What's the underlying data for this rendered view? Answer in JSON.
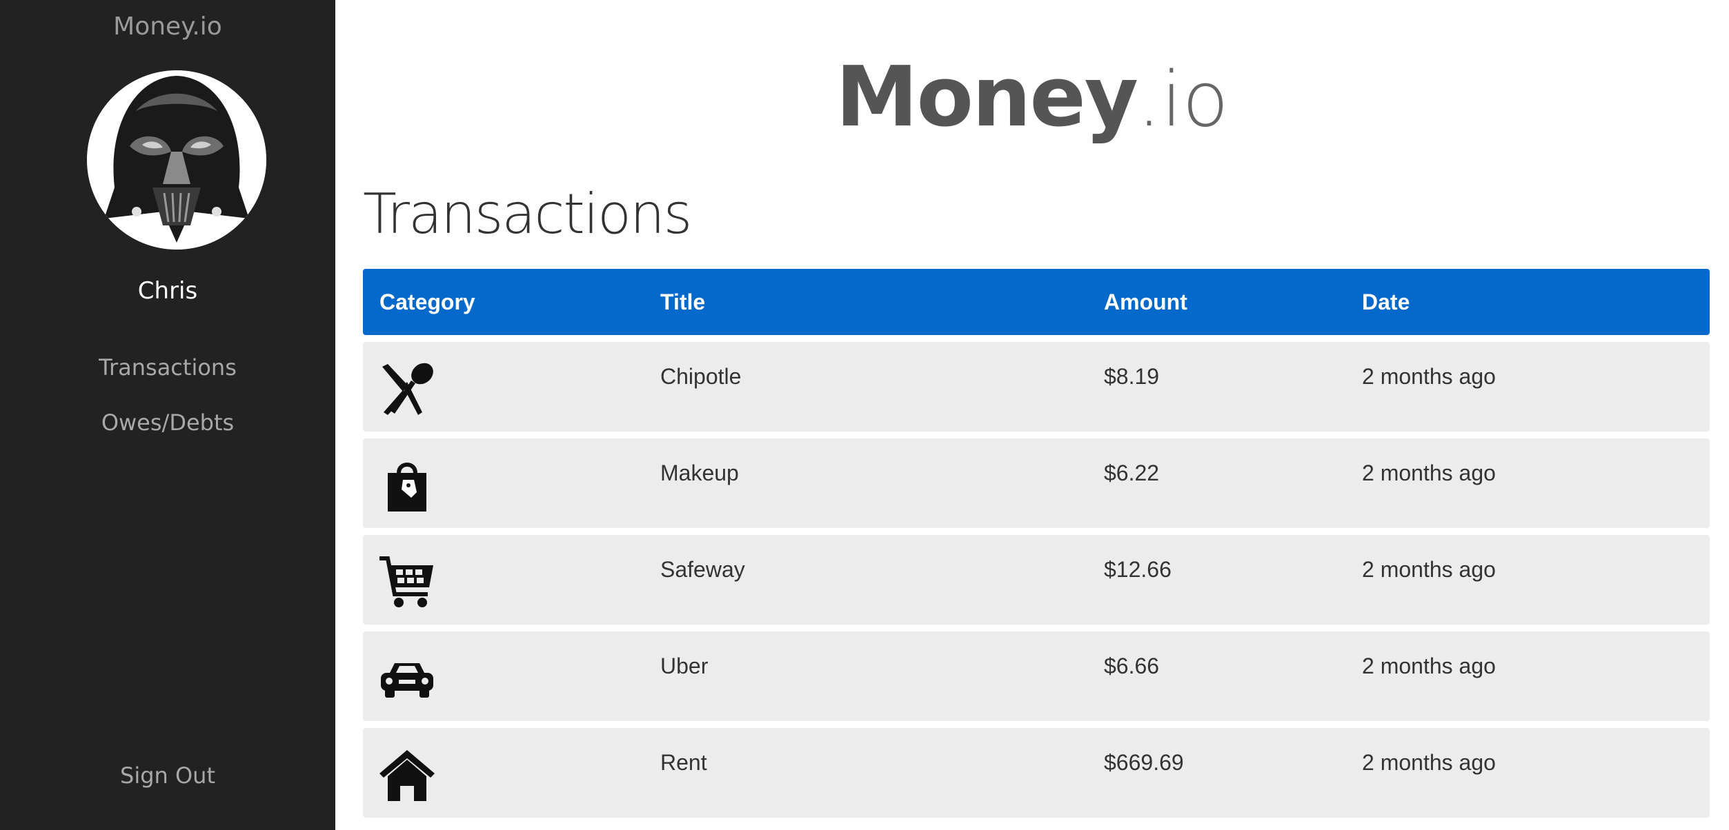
{
  "sidebar": {
    "brand": "Money.io",
    "username": "Chris",
    "nav": [
      {
        "label": "Transactions"
      },
      {
        "label": "Owes/Debts"
      }
    ],
    "signout": "Sign Out"
  },
  "header": {
    "logo_strong": "Money",
    "logo_light": ".io"
  },
  "main": {
    "title": "Transactions"
  },
  "table": {
    "columns": [
      "Category",
      "Title",
      "Amount",
      "Date"
    ],
    "rows": [
      {
        "icon": "restaurant-icon",
        "title": "Chipotle",
        "amount": "$8.19",
        "date": "2 months ago"
      },
      {
        "icon": "shopping-bag-icon",
        "title": "Makeup",
        "amount": "$6.22",
        "date": "2 months ago"
      },
      {
        "icon": "shopping-cart-icon",
        "title": "Safeway",
        "amount": "$12.66",
        "date": "2 months ago"
      },
      {
        "icon": "car-icon",
        "title": "Uber",
        "amount": "$6.66",
        "date": "2 months ago"
      },
      {
        "icon": "house-icon",
        "title": "Rent",
        "amount": "$669.69",
        "date": "2 months ago"
      }
    ]
  },
  "colors": {
    "sidebar_bg": "#222222",
    "header_bg": "#0569cb",
    "row_bg": "#ececec"
  }
}
